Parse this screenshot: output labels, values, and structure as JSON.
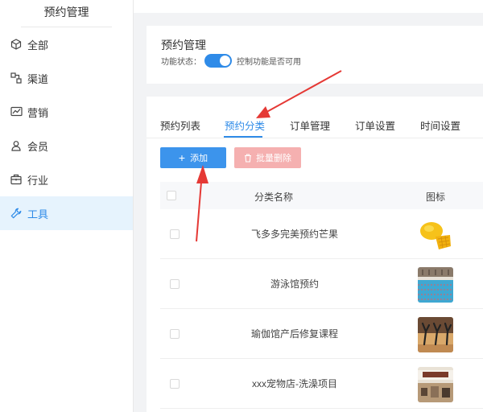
{
  "sidebar": {
    "title": "预约管理",
    "items": [
      {
        "label": "全部",
        "icon": "cube-icon"
      },
      {
        "label": "渠道",
        "icon": "channel-icon"
      },
      {
        "label": "营销",
        "icon": "chart-icon"
      },
      {
        "label": "会员",
        "icon": "user-icon"
      },
      {
        "label": "行业",
        "icon": "briefcase-icon"
      },
      {
        "label": "工具",
        "icon": "wrench-icon",
        "active": true
      }
    ]
  },
  "header": {
    "title": "预约管理",
    "status_label": "功能状态：",
    "status_enabled": true,
    "status_hint": "控制功能是否可用"
  },
  "tabs": [
    {
      "label": "预约列表"
    },
    {
      "label": "预约分类",
      "active": true
    },
    {
      "label": "订单管理"
    },
    {
      "label": "订单设置"
    },
    {
      "label": "时间设置"
    }
  ],
  "actions": {
    "add_label": "添加",
    "batch_delete_label": "批量删除"
  },
  "table": {
    "columns": [
      "分类名称",
      "图标"
    ],
    "rows": [
      {
        "name": "飞多多完美预约芒果",
        "icon": "mango-image"
      },
      {
        "name": "游泳馆预约",
        "icon": "swimming-pool-image"
      },
      {
        "name": "瑜伽馆产后修复课程",
        "icon": "yoga-image"
      },
      {
        "name": "xxx宠物店-洗澡项目",
        "icon": "pet-shop-image"
      }
    ]
  },
  "colors": {
    "accent": "#2f8be8",
    "danger_light": "#f5b0b0",
    "annotation_arrow": "#e53935"
  }
}
